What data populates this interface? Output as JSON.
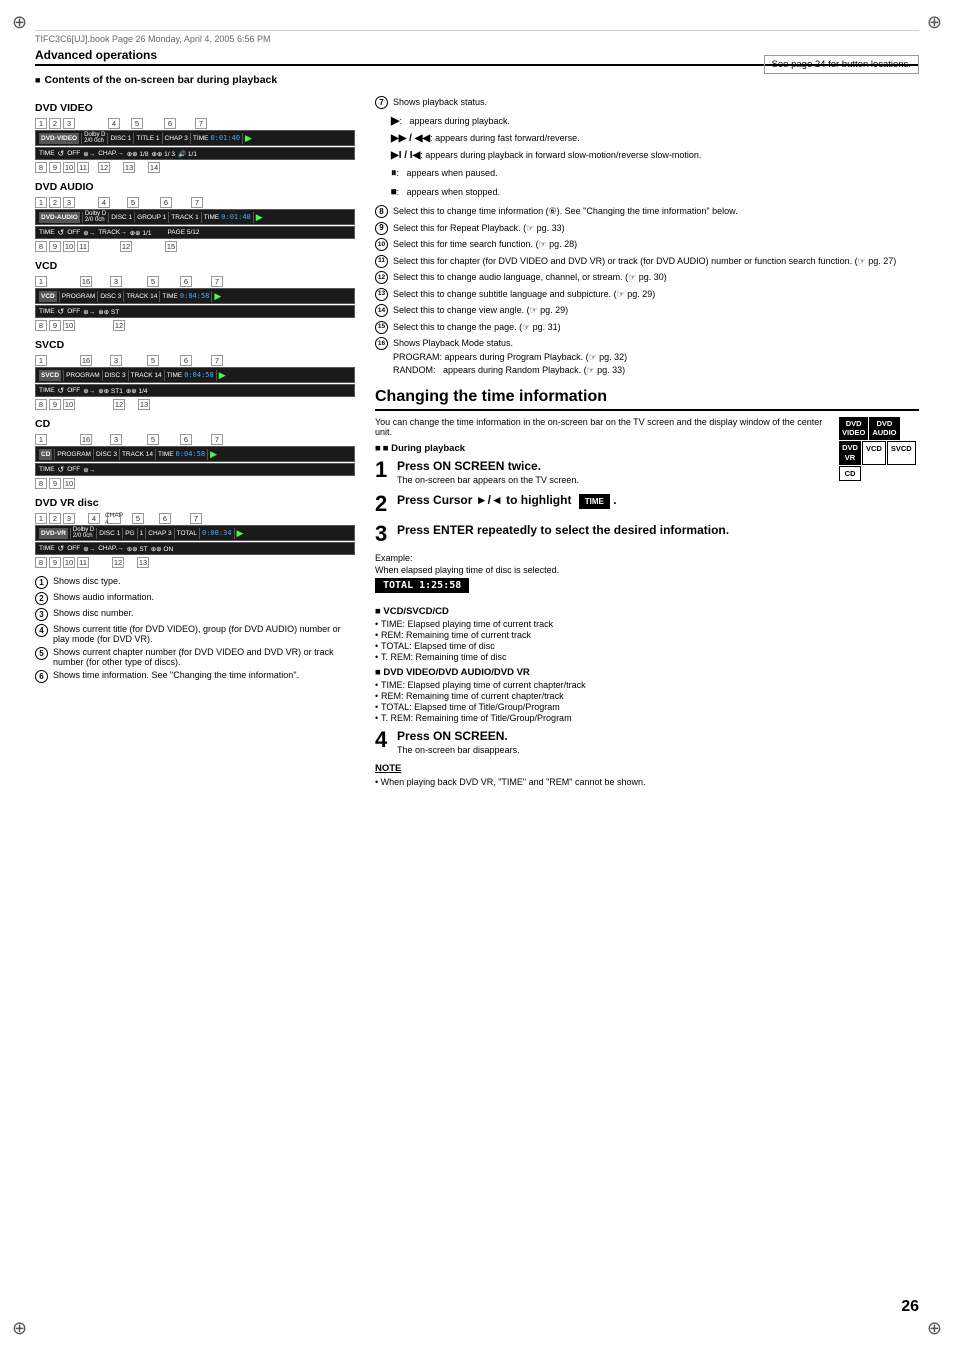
{
  "page": {
    "number": "26",
    "header_file": "TIFC3C6[UJ].book  Page 26  Monday, April 4, 2005  6:56 PM",
    "top_note": "See page 24 for button locations."
  },
  "advanced_operations": {
    "title": "Advanced operations",
    "subtitle": "■ Contents of the on-screen bar during playback",
    "sections": {
      "dvd_video": {
        "label": "DVD VIDEO",
        "main_bar": "DVD-VIDEO | Dolby D 2/0 0ch | DISC 1 | TITLE 1 | CHAP 3 | TIME 0:01:40 | ▶",
        "time_bar": "TIME ↺ OFF ⊕→ CHAP.→ ⊕⊕ 1/8 ⊕⊕ 1/ 3 🔊 1/1"
      },
      "dvd_audio": {
        "label": "DVD AUDIO",
        "main_bar": "DVD-AUDIO | Dolby D 2/0 0ch | DISC 1 | GROUP 1 | TRACK 1 | TIME 0:01:40 | ▶",
        "time_bar": "TIME ↺ OFF ⊕→ TRACK→ ⊕⊕ 1/1 | PAGE 5/12"
      },
      "vcd": {
        "label": "VCD",
        "main_bar": "VCD | PROGRAM | DISC 3 | TRACK 14 | TIME 0:04:58 | ▶",
        "time_bar": "TIME ↺ OFF ⊕→ ⊕⊕ ST"
      },
      "svcd": {
        "label": "SVCD",
        "main_bar": "SVCD | PROGRAM | DISC 3 | TRACK 14 | TIME 0:04:58 | ▶",
        "time_bar": "TIME ↺ OFF ⊕→ ⊕⊕ ST1 ⊕⊕ 1/4"
      },
      "cd": {
        "label": "CD",
        "main_bar": "CD | PROGRAM | DISC 3 | TRACK 14 | TIME 0:04:58 | ▶",
        "time_bar": "TIME ↺ OFF ⊕→"
      },
      "dvd_vr": {
        "label": "DVD VR disc",
        "main_bar": "DVD-VR | Dolby D 2/0 0ch | DISC 1 | PG | 1 | CHAP 3 | TOTAL | 0:00:34 | ▶",
        "time_bar": "TIME ↺ OFF ⊕→ CHAP.→ ⊕⊕ ST ⊕⊕ ON"
      }
    },
    "numbers_top": {
      "dvd_video": [
        "1",
        "2",
        "3",
        "4",
        "5",
        "6",
        "7"
      ],
      "dvd_audio": [
        "1",
        "2",
        "3",
        "4",
        "5",
        "6",
        "7"
      ],
      "vcd": [
        "1",
        "16",
        "3",
        "5",
        "6",
        "7"
      ],
      "svcd": [
        "1",
        "16",
        "3",
        "5",
        "6",
        "7"
      ],
      "cd": [
        "1",
        "16",
        "3",
        "5",
        "6",
        "7"
      ],
      "dvd_vr": [
        "1",
        "2",
        "3",
        "4",
        "5",
        "6",
        "7"
      ]
    },
    "numbers_bot": {
      "dvd_video": [
        "8",
        "9",
        "10",
        "11",
        "12",
        "13",
        "14"
      ],
      "dvd_audio": [
        "8",
        "9",
        "10",
        "11",
        "12",
        "15"
      ],
      "vcd": [
        "8",
        "9",
        "10",
        "12"
      ],
      "svcd": [
        "8",
        "9",
        "10",
        "12",
        "13"
      ],
      "cd": [
        "8",
        "9",
        "10"
      ],
      "dvd_vr": [
        "8",
        "9",
        "10",
        "11",
        "12",
        "13"
      ]
    }
  },
  "legend": {
    "items": [
      {
        "num": "1",
        "text": "Shows disc type."
      },
      {
        "num": "2",
        "text": "Shows audio information."
      },
      {
        "num": "3",
        "text": "Shows disc number."
      },
      {
        "num": "4",
        "text": "Shows current title (for DVD VIDEO), group (for DVD AUDIO) number or play mode (for DVD VR)."
      },
      {
        "num": "5",
        "text": "Shows current chapter number (for DVD VIDEO and DVD VR) or track number (for other type of discs)."
      },
      {
        "num": "6",
        "text": "Shows time information. See \"Changing the time information\"."
      }
    ]
  },
  "right_legend": {
    "items": [
      {
        "num": "7",
        "text": "Shows playback status."
      },
      {
        "num": "7a",
        "text": "▶:  appears during playback."
      },
      {
        "num": "7b",
        "text": "▶▶ / ◀◀:  appears during fast forward/reverse."
      },
      {
        "num": "7c",
        "text": "▶I / I◀:  appears during playback in forward slow-motion/reverse slow-motion."
      },
      {
        "num": "7d",
        "text": "⏸:  appears when paused."
      },
      {
        "num": "7e",
        "text": "⏹:  appears when stopped."
      },
      {
        "num": "8",
        "text": "Select this to change time information (⑥). See \"Changing the time information\" below."
      },
      {
        "num": "9",
        "text": "Select this for Repeat Playback. (☞ pg. 33)"
      },
      {
        "num": "10",
        "text": "Select this for time search function. (☞ pg. 28)"
      },
      {
        "num": "11",
        "text": "Select this for chapter (for DVD VIDEO and DVD VR) or track (for DVD AUDIO) number or function search function. (☞ pg. 27)"
      },
      {
        "num": "12",
        "text": "Select this to change audio language, channel, or stream. (☞ pg. 30)"
      },
      {
        "num": "13",
        "text": "Select this to change subtitle language and subpicture. (☞ pg. 29)"
      },
      {
        "num": "14",
        "text": "Select this to change view angle. (☞ pg. 29)"
      },
      {
        "num": "15",
        "text": "Select this to change the page. (☞ pg. 31)"
      },
      {
        "num": "16",
        "text": "Shows Playback Mode status.\nPROGRAM: appears during Program Playback. (☞ pg. 32)\nRANDOM:  appears during Random Playback. (☞ pg. 33)"
      }
    ]
  },
  "changing_time": {
    "title": "Changing the time information",
    "intro": "You can change the time information in the on-screen bar on the TV screen and the display window of the center unit.",
    "during_playback_label": "■ During playback",
    "steps": [
      {
        "num": "1",
        "title": "Press ON SCREEN twice.",
        "desc": "The on-screen bar appears on the TV screen."
      },
      {
        "num": "2",
        "title": "Press Cursor ►/◄ to highlight",
        "highlight": "TIME",
        "desc": "."
      },
      {
        "num": "3",
        "title": "Press ENTER repeatedly to select the desired information.",
        "desc": ""
      }
    ],
    "example_label": "Example:",
    "example_desc": "When elapsed playing time of disc is selected.",
    "total_display": "TOTAL 1:25:58",
    "vcd_section": {
      "title": "■ VCD/SVCD/CD",
      "bullets": [
        "TIME:   Elapsed playing time of current track",
        "REM:    Remaining time of current track",
        "TOTAL:  Elapsed time of disc",
        "T. REM: Remaining time of disc"
      ]
    },
    "dvd_section": {
      "title": "■ DVD VIDEO/DVD AUDIO/DVD VR",
      "bullets": [
        "TIME:   Elapsed playing time of current chapter/track",
        "REM:    Remaining time of current chapter/track",
        "TOTAL:  Elapsed time of Title/Group/Program",
        "T. REM: Remaining time of Title/Group/Program"
      ]
    },
    "step4": {
      "num": "4",
      "title": "Press ON SCREEN.",
      "desc": "The on-screen bar disappears."
    },
    "note": {
      "title": "NOTE",
      "text": "• When playing back DVD VR, \"TIME\" and \"REM\" cannot be shown."
    },
    "disc_badges": [
      {
        "line1": "DVD",
        "line2": "VIDEO"
      },
      {
        "line1": "DVD",
        "line2": "AUDIO"
      },
      {
        "line1": "DVD",
        "line2": "VR"
      },
      {
        "line1": "VCD",
        "line2": ""
      },
      {
        "line1": "SVCD",
        "line2": ""
      },
      {
        "line1": "CD",
        "line2": ""
      }
    ]
  }
}
